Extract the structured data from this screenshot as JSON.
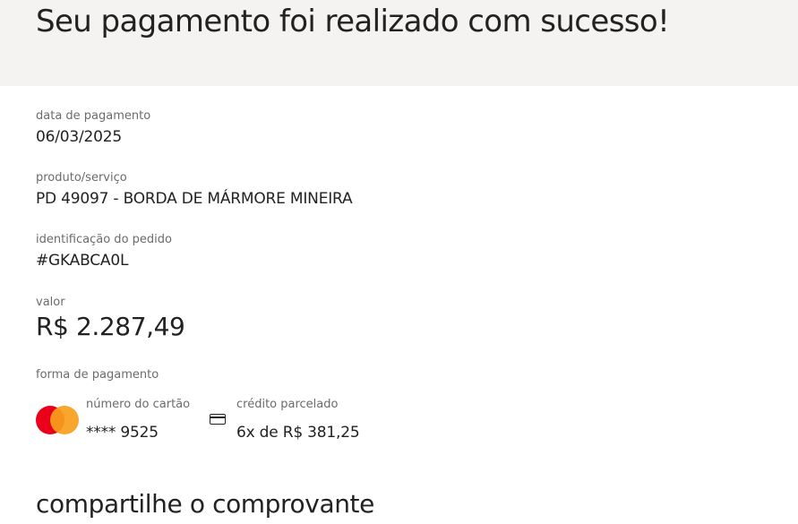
{
  "header": {
    "title": "Seu pagamento foi realizado com sucesso!"
  },
  "details": {
    "payment_date": {
      "label": "data de pagamento",
      "value": "06/03/2025"
    },
    "product": {
      "label": "produto/serviço",
      "value": "PD 49097 - BORDA DE MÁRMORE MINEIRA"
    },
    "order_id": {
      "label": "identificação do pedido",
      "value": "#GKABCA0L"
    },
    "amount": {
      "label": "valor",
      "value": "R$ 2.287,49"
    },
    "payment_method": {
      "label": "forma de pagamento",
      "card": {
        "brand_icon": "mastercard-logo",
        "label": "número do cartão",
        "value": "**** 9525"
      },
      "installments": {
        "icon": "credit-card-icon",
        "label": "crédito parcelado",
        "value": "6x de R$ 381,25"
      }
    }
  },
  "share": {
    "title": "compartilhe o comprovante"
  },
  "colors": {
    "header_bg": "#f4f3f1",
    "text": "#222222",
    "label": "#6b6b6b",
    "mastercard_red": "#eb001b",
    "mastercard_orange": "#f79e1b"
  }
}
